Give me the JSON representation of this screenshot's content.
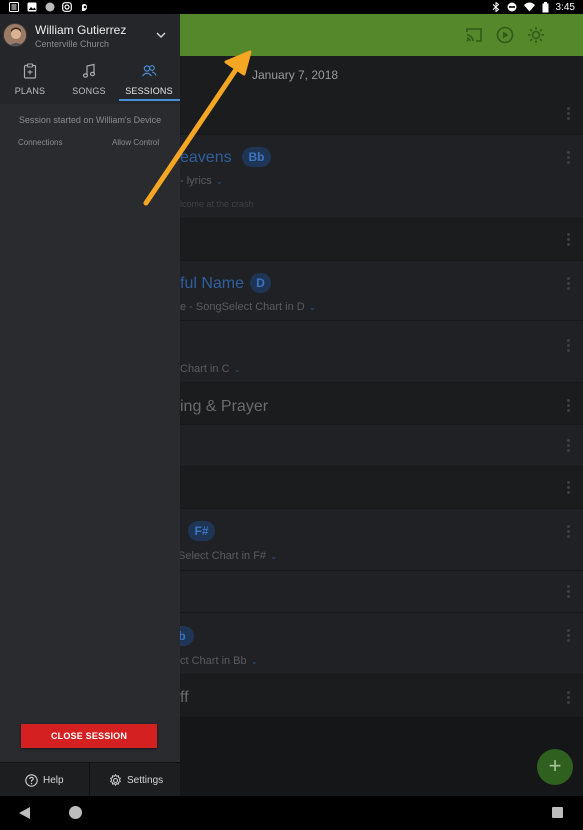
{
  "status_bar": {
    "time": "3:45",
    "left_icons": [
      "news-icon",
      "image-icon",
      "circle-icon",
      "instagram-icon",
      "hand-icon"
    ],
    "right_icons": [
      "bluetooth-icon",
      "do-not-disturb-icon",
      "wifi-icon",
      "battery-icon"
    ]
  },
  "app_bar": {
    "color": "#55882a",
    "icons": [
      "cast-icon",
      "play-icon",
      "brightness-icon"
    ]
  },
  "plan": {
    "date": "January 7, 2018",
    "items": [
      {
        "title": "eavens",
        "key": "Bb",
        "arrangement": "- lyrics",
        "note": "lcome at the crash"
      },
      {
        "title": "ful Name",
        "key": "D",
        "arrangement": "e - SongSelect Chart in D"
      },
      {
        "arrangement": "Chart in C"
      },
      {
        "heading": "ing & Prayer"
      },
      {
        "key": "F#",
        "arrangement": "Select Chart in F#"
      },
      {
        "key": "b",
        "arrangement": "ct Chart in Bb"
      },
      {
        "heading": "ff"
      }
    ]
  },
  "fab": {
    "symbol": "+"
  },
  "drawer": {
    "user": {
      "name": "William Gutierrez",
      "organization": "Centerville Church"
    },
    "tabs": [
      {
        "label": "PLANS",
        "icon": "clipboard-icon"
      },
      {
        "label": "SONGS",
        "icon": "music-note-icon"
      },
      {
        "label": "SESSIONS",
        "icon": "people-icon",
        "active": true
      }
    ],
    "session_status": "Session started on William's Device",
    "columns": {
      "connections": "Connections",
      "allow_control": "Allow Control"
    },
    "close_button": "CLOSE SESSION",
    "footer": {
      "help": "Help",
      "settings": "Settings"
    }
  },
  "colors": {
    "accent_blue": "#4a8fd8",
    "close_red": "#d42020",
    "annotation_arrow": "#f5a623"
  }
}
